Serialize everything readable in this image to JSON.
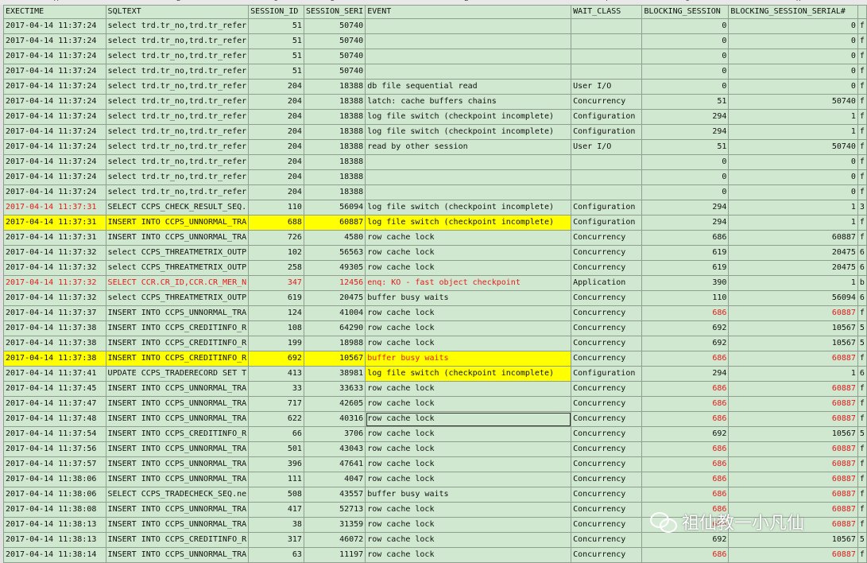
{
  "column_letters": [
    "A",
    "B",
    "C",
    "D",
    "E",
    "F",
    "G",
    "H"
  ],
  "headers": [
    "EXECTIME",
    "SQLTEXT",
    "SESSION_ID",
    "SESSION_SERI",
    "EVENT",
    "WAIT_CLASS",
    "BLOCKING_SESSION",
    "BLOCKING_SESSION_SERIAL#",
    ""
  ],
  "rows": [
    {
      "t": "2017-04-14 11:37:24",
      "sql": "select trd.tr_no,trd.tr_refer",
      "sid": "51",
      "ser": "50740",
      "ev": "",
      "wc": "",
      "bs": "0",
      "bss": "0",
      "x": "f"
    },
    {
      "t": "2017-04-14 11:37:24",
      "sql": "select trd.tr_no,trd.tr_refer",
      "sid": "51",
      "ser": "50740",
      "ev": "",
      "wc": "",
      "bs": "0",
      "bss": "0",
      "x": "f"
    },
    {
      "t": "2017-04-14 11:37:24",
      "sql": "select trd.tr_no,trd.tr_refer",
      "sid": "51",
      "ser": "50740",
      "ev": "",
      "wc": "",
      "bs": "0",
      "bss": "0",
      "x": "f"
    },
    {
      "t": "2017-04-14 11:37:24",
      "sql": "select trd.tr_no,trd.tr_refer",
      "sid": "51",
      "ser": "50740",
      "ev": "",
      "wc": "",
      "bs": "0",
      "bss": "0",
      "x": "f"
    },
    {
      "t": "2017-04-14 11:37:24",
      "sql": "select trd.tr_no,trd.tr_refer",
      "sid": "204",
      "ser": "18388",
      "ev": "db file sequential read",
      "wc": "User I/O",
      "bs": "0",
      "bss": "0",
      "x": "f"
    },
    {
      "t": "2017-04-14 11:37:24",
      "sql": "select trd.tr_no,trd.tr_refer",
      "sid": "204",
      "ser": "18388",
      "ev": "latch: cache buffers chains",
      "wc": "Concurrency",
      "bs": "51",
      "bss": "50740",
      "x": "f"
    },
    {
      "t": "2017-04-14 11:37:24",
      "sql": "select trd.tr_no,trd.tr_refer",
      "sid": "204",
      "ser": "18388",
      "ev": "log file switch (checkpoint incomplete)",
      "wc": "Configuration",
      "bs": "294",
      "bss": "1",
      "x": "f"
    },
    {
      "t": "2017-04-14 11:37:24",
      "sql": "select trd.tr_no,trd.tr_refer",
      "sid": "204",
      "ser": "18388",
      "ev": "log file switch (checkpoint incomplete)",
      "wc": "Configuration",
      "bs": "294",
      "bss": "1",
      "x": "f"
    },
    {
      "t": "2017-04-14 11:37:24",
      "sql": "select trd.tr_no,trd.tr_refer",
      "sid": "204",
      "ser": "18388",
      "ev": "read by other session",
      "wc": "User I/O",
      "bs": "51",
      "bss": "50740",
      "x": "f"
    },
    {
      "t": "2017-04-14 11:37:24",
      "sql": "select trd.tr_no,trd.tr_refer",
      "sid": "204",
      "ser": "18388",
      "ev": "",
      "wc": "",
      "bs": "0",
      "bss": "0",
      "x": "f"
    },
    {
      "t": "2017-04-14 11:37:24",
      "sql": "select trd.tr_no,trd.tr_refer",
      "sid": "204",
      "ser": "18388",
      "ev": "",
      "wc": "",
      "bs": "0",
      "bss": "0",
      "x": "f"
    },
    {
      "t": "2017-04-14 11:37:24",
      "sql": "select trd.tr_no,trd.tr_refer",
      "sid": "204",
      "ser": "18388",
      "ev": "",
      "wc": "",
      "bs": "0",
      "bss": "0",
      "x": "f"
    },
    {
      "t": "2017-04-14 11:37:31",
      "sql": "SELECT CCPS_CHECK_RESULT_SEQ.",
      "sid": "110",
      "ser": "56094",
      "ev": "log file switch (checkpoint incomplete)",
      "wc": "Configuration",
      "bs": "294",
      "bss": "1",
      "x": "3",
      "redtime": true
    },
    {
      "t": "2017-04-14 11:37:31",
      "sql": "INSERT INTO CCPS_UNNORMAL_TRA",
      "sid": "688",
      "ser": "60887",
      "ev": "log file switch (checkpoint incomplete)",
      "wc": "Configuration",
      "bs": "294",
      "bss": "1",
      "x": "f",
      "hl": "full"
    },
    {
      "t": "2017-04-14 11:37:31",
      "sql": "INSERT INTO CCPS_UNNORMAL_TRA",
      "sid": "726",
      "ser": "4580",
      "ev": "row cache lock",
      "wc": "Concurrency",
      "bs": "686",
      "bss": "60887",
      "x": "f"
    },
    {
      "t": "2017-04-14 11:37:32",
      "sql": "select CCPS_THREATMETRIX_OUTP",
      "sid": "102",
      "ser": "56563",
      "ev": "row cache lock",
      "wc": "Concurrency",
      "bs": "619",
      "bss": "20475",
      "x": "6"
    },
    {
      "t": "2017-04-14 11:37:32",
      "sql": "select CCPS_THREATMETRIX_OUTP",
      "sid": "258",
      "ser": "49305",
      "ev": "row cache lock",
      "wc": "Concurrency",
      "bs": "619",
      "bss": "20475",
      "x": "6"
    },
    {
      "t": "2017-04-14 11:37:32",
      "sql": "SELECT CCR.CR_ID,CCR.CR_MER_N",
      "sid": "347",
      "ser": "12456",
      "ev": "enq: KO - fast object checkpoint",
      "wc": "Application",
      "bs": "390",
      "bss": "1",
      "x": "b",
      "redrow": true
    },
    {
      "t": "2017-04-14 11:37:32",
      "sql": "select CCPS_THREATMETRIX_OUTP",
      "sid": "619",
      "ser": "20475",
      "ev": "buffer busy waits",
      "wc": "Concurrency",
      "bs": "110",
      "bss": "56094",
      "x": "6"
    },
    {
      "t": "2017-04-14 11:37:37",
      "sql": "INSERT INTO CCPS_UNNORMAL_TRA",
      "sid": "124",
      "ser": "41004",
      "ev": "row cache lock",
      "wc": "Concurrency",
      "bs": "686",
      "bss": "60887",
      "x": "f",
      "redblk": true
    },
    {
      "t": "2017-04-14 11:37:38",
      "sql": "INSERT INTO CCPS_CREDITINFO_R",
      "sid": "108",
      "ser": "64290",
      "ev": "row cache lock",
      "wc": "Concurrency",
      "bs": "692",
      "bss": "10567",
      "x": "5"
    },
    {
      "t": "2017-04-14 11:37:38",
      "sql": "INSERT INTO CCPS_CREDITINFO_R",
      "sid": "199",
      "ser": "18988",
      "ev": "row cache lock",
      "wc": "Concurrency",
      "bs": "692",
      "bss": "10567",
      "x": "5"
    },
    {
      "t": "2017-04-14 11:37:38",
      "sql": "INSERT INTO CCPS_CREDITINFO_R",
      "sid": "692",
      "ser": "10567",
      "ev": "buffer busy waits",
      "wc": "Concurrency",
      "bs": "686",
      "bss": "60887",
      "x": "f",
      "hl": "left",
      "redev": true,
      "redblk": true
    },
    {
      "t": "2017-04-14 11:37:41",
      "sql": "UPDATE CCPS_TRADERECORD SET T",
      "sid": "413",
      "ser": "38981",
      "ev": "log file switch (checkpoint incomplete)",
      "wc": "Configuration",
      "bs": "294",
      "bss": "1",
      "x": "6",
      "hl": "ev"
    },
    {
      "t": "2017-04-14 11:37:45",
      "sql": "INSERT INTO CCPS_UNNORMAL_TRA",
      "sid": "33",
      "ser": "33633",
      "ev": "row cache lock",
      "wc": "Concurrency",
      "bs": "686",
      "bss": "60887",
      "x": "f",
      "redblk": true
    },
    {
      "t": "2017-04-14 11:37:47",
      "sql": "INSERT INTO CCPS_UNNORMAL_TRA",
      "sid": "717",
      "ser": "42605",
      "ev": "row cache lock",
      "wc": "Concurrency",
      "bs": "686",
      "bss": "60887",
      "x": "f",
      "redblk": true
    },
    {
      "t": "2017-04-14 11:37:48",
      "sql": "INSERT INTO CCPS_UNNORMAL_TRA",
      "sid": "622",
      "ser": "40316",
      "ev": "row cache lock",
      "wc": "Concurrency",
      "bs": "686",
      "bss": "60887",
      "x": "f",
      "redblk": true,
      "sel": true
    },
    {
      "t": "2017-04-14 11:37:54",
      "sql": "INSERT INTO CCPS_CREDITINFO_R",
      "sid": "66",
      "ser": "3706",
      "ev": "row cache lock",
      "wc": "Concurrency",
      "bs": "692",
      "bss": "10567",
      "x": "5"
    },
    {
      "t": "2017-04-14 11:37:56",
      "sql": "INSERT INTO CCPS_UNNORMAL_TRA",
      "sid": "501",
      "ser": "43043",
      "ev": "row cache lock",
      "wc": "Concurrency",
      "bs": "686",
      "bss": "60887",
      "x": "f",
      "redblk": true
    },
    {
      "t": "2017-04-14 11:37:57",
      "sql": "INSERT INTO CCPS_UNNORMAL_TRA",
      "sid": "396",
      "ser": "47641",
      "ev": "row cache lock",
      "wc": "Concurrency",
      "bs": "686",
      "bss": "60887",
      "x": "f",
      "redblk": true
    },
    {
      "t": "2017-04-14 11:38:06",
      "sql": "INSERT INTO CCPS_UNNORMAL_TRA",
      "sid": "111",
      "ser": "4047",
      "ev": "row cache lock",
      "wc": "Concurrency",
      "bs": "686",
      "bss": "60887",
      "x": "f",
      "redblk": true
    },
    {
      "t": "2017-04-14 11:38:06",
      "sql": "SELECT CCPS_TRADECHECK_SEQ.ne",
      "sid": "508",
      "ser": "43557",
      "ev": "buffer busy waits",
      "wc": "Concurrency",
      "bs": "686",
      "bss": "60887",
      "x": "f",
      "redblk": true
    },
    {
      "t": "2017-04-14 11:38:08",
      "sql": "INSERT INTO CCPS_UNNORMAL_TRA",
      "sid": "417",
      "ser": "52713",
      "ev": "row cache lock",
      "wc": "Concurrency",
      "bs": "686",
      "bss": "60887",
      "x": "f",
      "redblk": true
    },
    {
      "t": "2017-04-14 11:38:13",
      "sql": "INSERT INTO CCPS_UNNORMAL_TRA",
      "sid": "38",
      "ser": "31359",
      "ev": "row cache lock",
      "wc": "Concurrency",
      "bs": "686",
      "bss": "60887",
      "x": "f",
      "redblk": true
    },
    {
      "t": "2017-04-14 11:38:13",
      "sql": "INSERT INTO CCPS_CREDITINFO_R",
      "sid": "317",
      "ser": "46072",
      "ev": "row cache lock",
      "wc": "Concurrency",
      "bs": "692",
      "bss": "10567",
      "x": "5"
    },
    {
      "t": "2017-04-14 11:38:14",
      "sql": "INSERT INTO CCPS_UNNORMAL_TRA",
      "sid": "63",
      "ser": "11197",
      "ev": "row cache lock",
      "wc": "Concurrency",
      "bs": "686",
      "bss": "60887",
      "x": "f",
      "redblk": true
    }
  ],
  "watermark": {
    "text": "祖仙教一小凡仙",
    "icon": "wechat-icon"
  },
  "colors": {
    "highlight": "#ffff00",
    "red": "#e8191b",
    "cell_bg": "#cfe8cf"
  }
}
